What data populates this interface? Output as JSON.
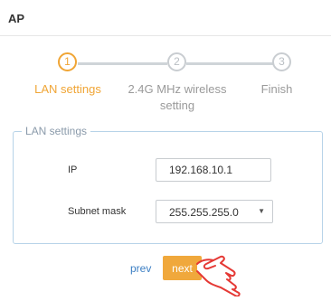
{
  "header": {
    "title": "AP"
  },
  "stepper": {
    "steps": [
      {
        "number": "1",
        "label": "LAN settings",
        "state": "active"
      },
      {
        "number": "2",
        "label_line1": "2.4G MHz wireless",
        "label_line2": "setting",
        "state": "pending"
      },
      {
        "number": "3",
        "label": "Finish",
        "state": "pending"
      }
    ]
  },
  "form": {
    "legend": "LAN settings",
    "ip": {
      "label": "IP",
      "value": "192.168.10.1"
    },
    "subnet_mask": {
      "label": "Subnet mask",
      "value": "255.255.255.0",
      "caret": "▼"
    }
  },
  "actions": {
    "prev_label": "prev",
    "next_label": "next"
  },
  "colors": {
    "accent": "#f0a535",
    "link": "#3c7fc4",
    "pointer": "#e53935"
  }
}
